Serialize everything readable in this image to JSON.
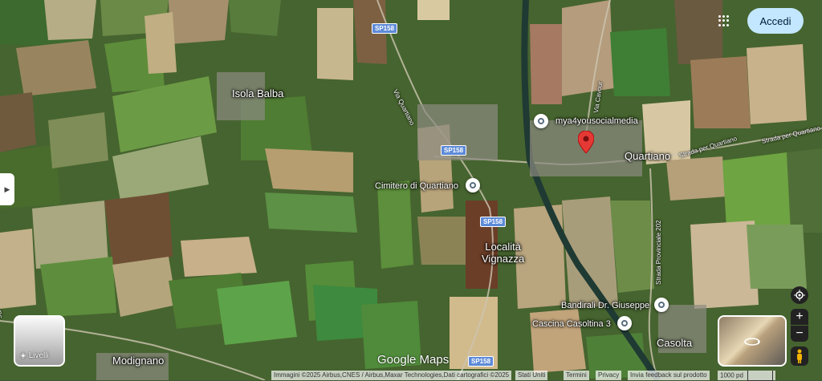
{
  "header": {
    "accedi_label": "Accedi",
    "apps_icon": "apps-grid-icon"
  },
  "map": {
    "places": {
      "isola_balba": "Isola Balba",
      "quartiano": "Quartiano",
      "cimitero": "Cimitero di Quartiano",
      "localita_line1": "Località",
      "localita_line2": "Vignazza",
      "mya4you": "mya4yousocialmedia",
      "modignano": "Modignano",
      "casolta": "Casolta",
      "bandirali": "Bandirali Dr. Giuseppe",
      "cascina": "Cascina Casoltina 3"
    },
    "roads": {
      "via_quartiano": "Via Quartiano",
      "via_cavour": "Via Cavour",
      "strada_quartiano_1": "Strada per Quartiano",
      "strada_quartiano_2": "Strada per Quartiano",
      "strada_provinciale": "Strada Provinciale 202",
      "dc": "Dc"
    },
    "road_badges": [
      "SP158",
      "SP158",
      "SP158",
      "SP158"
    ],
    "colors": {
      "selected_pin": "#e53935",
      "accent": "#c2e7ff"
    }
  },
  "controls": {
    "layers_label": "Livelli",
    "zoom_in": "+",
    "zoom_out": "−",
    "collapse_icon": "chevron-right-icon"
  },
  "branding": {
    "logo": "Google Maps"
  },
  "footer": {
    "attribution": "Immagini ©2025 Airbus,CNES / Airbus,Maxar Technologies,Dati cartografici ©2025",
    "country": "Stati Uniti",
    "terms": "Termini",
    "privacy": "Privacy",
    "feedback": "Invia feedback sul prodotto",
    "scale": "1000 pd"
  }
}
